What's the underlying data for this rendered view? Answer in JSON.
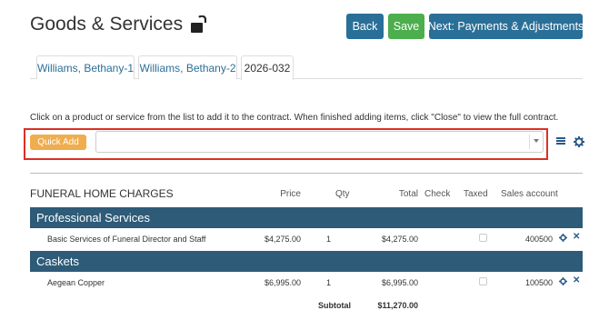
{
  "page": {
    "title": "Goods & Services"
  },
  "toolbar": {
    "back_label": "Back",
    "save_label": "Save",
    "next_label": "Next: Payments & Adjustments"
  },
  "tabs": [
    {
      "label": "Williams, Bethany-1"
    },
    {
      "label": "Williams, Bethany-2"
    },
    {
      "label": "2026-032"
    }
  ],
  "instructions": "Click on a product or service from the list to add it to the contract. When finished adding items, click \"Close\" to view the full contract.",
  "quick_add": {
    "button_label": "Quick Add",
    "select_value": ""
  },
  "table": {
    "section_title": "FUNERAL HOME CHARGES",
    "columns": {
      "price": "Price",
      "qty": "Qty",
      "total": "Total",
      "check": "Check",
      "taxed": "Taxed",
      "sales_account": "Sales account"
    },
    "categories": [
      {
        "name": "Professional Services",
        "items": [
          {
            "name": "Basic Services of Funeral Director and Staff",
            "price": "$4,275.00",
            "qty": "1",
            "total": "$4,275.00",
            "sales_account": "400500"
          }
        ]
      },
      {
        "name": "Caskets",
        "items": [
          {
            "name": "Aegean Copper",
            "price": "$6,995.00",
            "qty": "1",
            "total": "$6,995.00",
            "sales_account": "100500"
          }
        ]
      }
    ],
    "subtotal_label": "Subtotal",
    "subtotal_value": "$11,270.00"
  },
  "colors": {
    "primary": "#2a6f97",
    "success": "#4cae4c",
    "warning": "#f0ad4e",
    "category_bar": "#2e5b78",
    "highlight": "#d93025"
  }
}
